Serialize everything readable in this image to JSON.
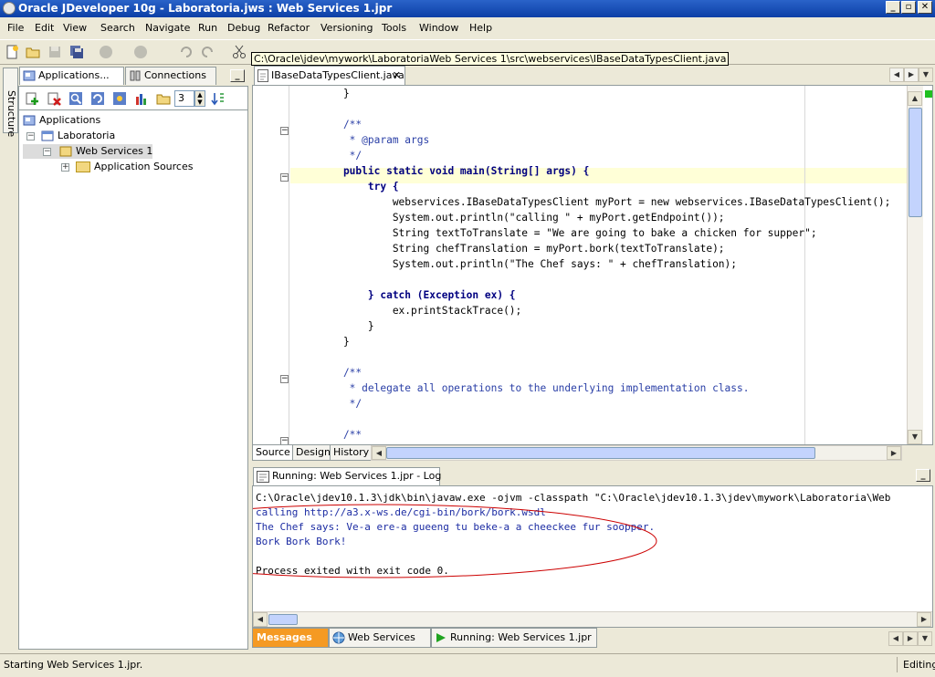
{
  "window": {
    "title": "Oracle JDeveloper 10g - Laboratoria.jws : Web Services 1.jpr",
    "min": "_",
    "max": "▫",
    "close": "✕"
  },
  "menu": [
    "File",
    "Edit",
    "View",
    "Search",
    "Navigate",
    "Run",
    "Debug",
    "Refactor",
    "Versioning",
    "Tools",
    "Window",
    "Help"
  ],
  "tooltip": "C:\\Oracle\\jdev\\mywork\\LaboratoriaWeb Services 1\\src\\webservices\\IBaseDataTypesClient.java",
  "structure_tab": "Structure",
  "navigator": {
    "tabs": [
      "Applications...",
      "Connections"
    ],
    "spinner_value": "3",
    "tree": [
      "Applications",
      "Laboratoria",
      "Web Services 1",
      "Application Sources"
    ]
  },
  "editor": {
    "tab": "IBaseDataTypesClient.java",
    "lines": [
      {
        "t": "    }",
        "c": "pl"
      },
      {
        "t": "",
        "c": "pl"
      },
      {
        "t": "    /**",
        "c": "cmt"
      },
      {
        "t": "     * @param args",
        "c": "cmt"
      },
      {
        "t": "     */",
        "c": "cmt"
      },
      {
        "t": "    public static void main(String[] args) {",
        "c": "kw"
      },
      {
        "t": "        try {",
        "c": "kw"
      },
      {
        "t": "            webservices.IBaseDataTypesClient myPort = new webservices.IBaseDataTypesClient();",
        "c": "pl"
      },
      {
        "t": "            System.out.println(\"calling \" + myPort.getEndpoint());",
        "c": "pl"
      },
      {
        "t": "            String textToTranslate = \"We are going to bake a chicken for supper\";",
        "c": "pl"
      },
      {
        "t": "            String chefTranslation = myPort.bork(textToTranslate);",
        "c": "pl"
      },
      {
        "t": "            System.out.println(\"The Chef says: \" + chefTranslation);",
        "c": "pl"
      },
      {
        "t": "",
        "c": "pl"
      },
      {
        "t": "        } catch (Exception ex) {",
        "c": "kw"
      },
      {
        "t": "            ex.printStackTrace();",
        "c": "pl"
      },
      {
        "t": "        }",
        "c": "pl"
      },
      {
        "t": "    }",
        "c": "pl"
      },
      {
        "t": "",
        "c": "pl"
      },
      {
        "t": "    /**",
        "c": "cmt"
      },
      {
        "t": "     * delegate all operations to the underlying implementation class.",
        "c": "cmt"
      },
      {
        "t": "     */",
        "c": "cmt"
      },
      {
        "t": "",
        "c": "pl"
      },
      {
        "t": "    /**",
        "c": "cmt"
      }
    ],
    "bottom_tabs": [
      "Source",
      "Design",
      "History"
    ]
  },
  "log": {
    "tab": "Running: Web Services 1.jpr - Log",
    "lines": [
      {
        "t": "C:\\Oracle\\jdev10.1.3\\jdk\\bin\\javaw.exe -ojvm -classpath \"C:\\Oracle\\jdev10.1.3\\jdev\\mywork\\Laboratoria\\Web",
        "c": "pl"
      },
      {
        "t": "calling http://a3.x-ws.de/cgi-bin/bork/bork.wsdl",
        "c": "blue"
      },
      {
        "t": "The Chef says: Ve-a ere-a gueeng tu beke-a a cheeckee fur soopper.",
        "c": "blue"
      },
      {
        "t": "Bork Bork Bork!",
        "c": "blue"
      },
      {
        "t": "",
        "c": "pl"
      },
      {
        "t": "Process exited with exit code 0.",
        "c": "pl"
      }
    ]
  },
  "dock_tabs": [
    "Messages",
    "Web Services",
    "Running: Web Services 1.jpr"
  ],
  "status": {
    "left": "Starting Web Services 1.jpr.",
    "right": "Editing"
  },
  "colors": {
    "titlebar": "#0c3fa6",
    "messages_tab": "#f59a23",
    "annotation_ellipse": "#cc0000"
  }
}
